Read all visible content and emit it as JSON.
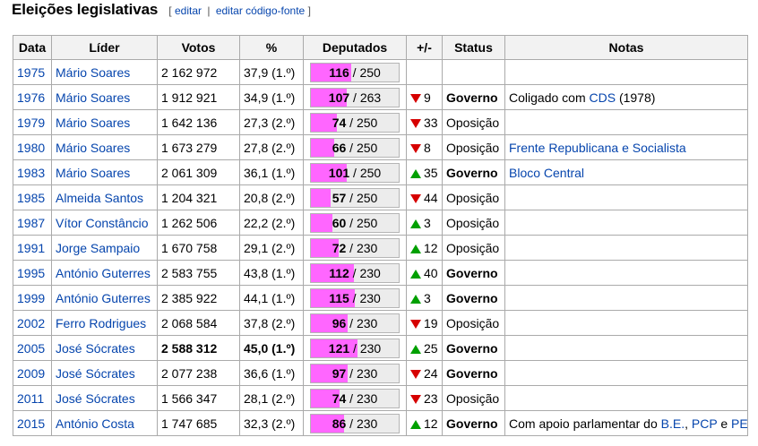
{
  "heading": {
    "title": "Eleições legislativas",
    "open_bracket": "[",
    "edit_label": "editar",
    "separator": "|",
    "edit_source_label": "editar código-fonte",
    "close_bracket": "]"
  },
  "colors": {
    "bar_fill": "#ff66ff",
    "up_arrow": "#00a000",
    "down_arrow": "#d60000",
    "link": "#0645ad"
  },
  "table": {
    "headers": [
      "Data",
      "Líder",
      "Votos",
      "%",
      "Deputados",
      "+/-",
      "Status",
      "Notas"
    ],
    "rows": [
      {
        "year": "1975",
        "leader": "Mário Soares",
        "votes": "2 162 972",
        "pct": "37,9 (1.º)",
        "seats": "116",
        "total": "250",
        "delta": "",
        "dir": "",
        "status": "",
        "notes": []
      },
      {
        "year": "1976",
        "leader": "Mário Soares",
        "votes": "1 912 921",
        "pct": "34,9 (1.º)",
        "seats": "107",
        "total": "263",
        "delta": "9",
        "dir": "down",
        "status": "Governo",
        "notes": [
          {
            "t": "Coligado com ",
            "l": false
          },
          {
            "t": "CDS",
            "l": true
          },
          {
            "t": " (1978)",
            "l": false
          }
        ]
      },
      {
        "year": "1979",
        "leader": "Mário Soares",
        "votes": "1 642 136",
        "pct": "27,3 (2.º)",
        "seats": "74",
        "total": "250",
        "delta": "33",
        "dir": "down",
        "status": "Oposição",
        "notes": []
      },
      {
        "year": "1980",
        "leader": "Mário Soares",
        "votes": "1 673 279",
        "pct": "27,8 (2.º)",
        "seats": "66",
        "total": "250",
        "delta": "8",
        "dir": "down",
        "status": "Oposição",
        "notes": [
          {
            "t": "Frente Republicana e Socialista",
            "l": true
          }
        ]
      },
      {
        "year": "1983",
        "leader": "Mário Soares",
        "votes": "2 061 309",
        "pct": "36,1 (1.º)",
        "seats": "101",
        "total": "250",
        "delta": "35",
        "dir": "up",
        "status": "Governo",
        "notes": [
          {
            "t": "Bloco Central",
            "l": true
          }
        ]
      },
      {
        "year": "1985",
        "leader": "Almeida Santos",
        "votes": "1 204 321",
        "pct": "20,8 (2.º)",
        "seats": "57",
        "total": "250",
        "delta": "44",
        "dir": "down",
        "status": "Oposição",
        "notes": []
      },
      {
        "year": "1987",
        "leader": "Vítor Constâncio",
        "votes": "1 262 506",
        "pct": "22,2 (2.º)",
        "seats": "60",
        "total": "250",
        "delta": "3",
        "dir": "up",
        "status": "Oposição",
        "notes": []
      },
      {
        "year": "1991",
        "leader": "Jorge Sampaio",
        "votes": "1 670 758",
        "pct": "29,1 (2.º)",
        "seats": "72",
        "total": "230",
        "delta": "12",
        "dir": "up",
        "status": "Oposição",
        "notes": []
      },
      {
        "year": "1995",
        "leader": "António Guterres",
        "votes": "2 583 755",
        "pct": "43,8 (1.º)",
        "seats": "112",
        "total": "230",
        "delta": "40",
        "dir": "up",
        "status": "Governo",
        "notes": []
      },
      {
        "year": "1999",
        "leader": "António Guterres",
        "votes": "2 385 922",
        "pct": "44,1 (1.º)",
        "seats": "115",
        "total": "230",
        "delta": "3",
        "dir": "up",
        "status": "Governo",
        "notes": []
      },
      {
        "year": "2002",
        "leader": "Ferro Rodrigues",
        "votes": "2 068 584",
        "pct": "37,8 (2.º)",
        "seats": "96",
        "total": "230",
        "delta": "19",
        "dir": "down",
        "status": "Oposição",
        "notes": []
      },
      {
        "year": "2005",
        "leader": "José Sócrates",
        "votes": "2 588 312",
        "pct": "45,0 (1.º)",
        "seats": "121",
        "total": "230",
        "delta": "25",
        "dir": "up",
        "status": "Governo",
        "notes": [],
        "emph": true
      },
      {
        "year": "2009",
        "leader": "José Sócrates",
        "votes": "2 077 238",
        "pct": "36,6 (1.º)",
        "seats": "97",
        "total": "230",
        "delta": "24",
        "dir": "down",
        "status": "Governo",
        "notes": []
      },
      {
        "year": "2011",
        "leader": "José Sócrates",
        "votes": "1 566 347",
        "pct": "28,1 (2.º)",
        "seats": "74",
        "total": "230",
        "delta": "23",
        "dir": "down",
        "status": "Oposição",
        "notes": []
      },
      {
        "year": "2015",
        "leader": "António Costa",
        "votes": "1 747 685",
        "pct": "32,3 (2.º)",
        "seats": "86",
        "total": "230",
        "delta": "12",
        "dir": "up",
        "status": "Governo",
        "notes": [
          {
            "t": "Com apoio parlamentar do ",
            "l": false
          },
          {
            "t": "B.E.",
            "l": true
          },
          {
            "t": ", ",
            "l": false
          },
          {
            "t": "PCP",
            "l": true
          },
          {
            "t": " e ",
            "l": false
          },
          {
            "t": "PEV",
            "l": true
          }
        ]
      }
    ]
  }
}
